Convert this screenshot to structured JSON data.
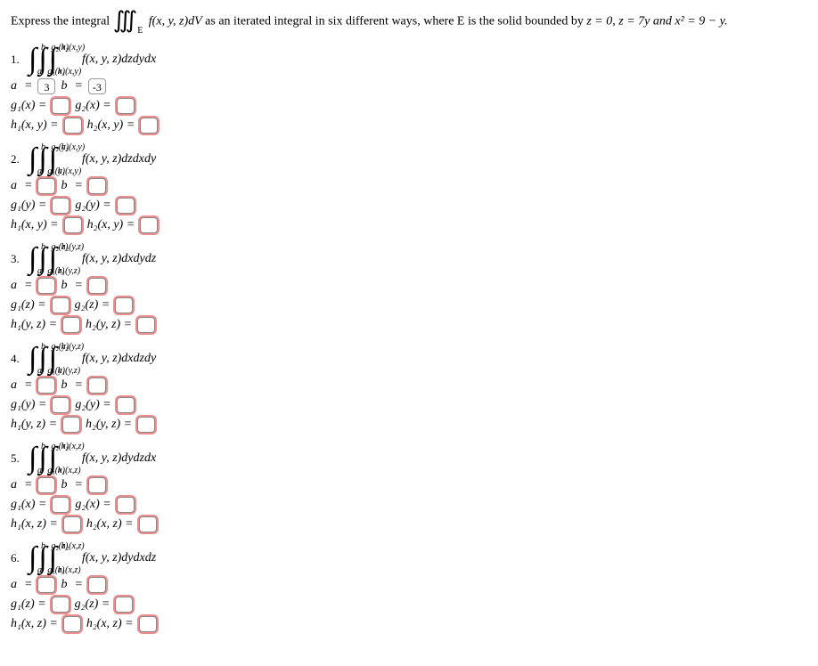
{
  "intro": {
    "lead": "Express the integral",
    "iiint": "∭",
    "sub": "E",
    "fn": "f(x, y, z)dV",
    "mid": " as an iterated integral in six different ways, where E is the solid bounded by ",
    "cond": "z = 0, z = 7y and x² = 9 − y."
  },
  "problems": [
    {
      "n": "1.",
      "lim1_top": "b",
      "lim1_bot": "a",
      "lim2_top": "g₂(x)",
      "lim2_bot": "g₁(x)",
      "lim3_top": "h₂(x,y)",
      "lim3_bot": "h₁(x,y)",
      "integrand": "f(x, y, z)dzdydx",
      "a_val": "3",
      "b_val": "-3",
      "a_filled": true,
      "b_filled": true,
      "g1": "g₁(x) =",
      "g2": "g₂(x) =",
      "h1": "h₁(x, y) =",
      "h2": "h₂(x, y) ="
    },
    {
      "n": "2.",
      "lim1_top": "b",
      "lim1_bot": "a",
      "lim2_top": "g₂(y)",
      "lim2_bot": "g₁(y)",
      "lim3_top": "h₂(x,y)",
      "lim3_bot": "h₁(x,y)",
      "integrand": "f(x, y, z)dzdxdy",
      "a_val": "",
      "b_val": "",
      "a_filled": false,
      "b_filled": false,
      "g1": "g₁(y) =",
      "g2": "g₂(y) =",
      "h1": "h₁(x, y) =",
      "h2": "h₂(x, y) ="
    },
    {
      "n": "3.",
      "lim1_top": "b",
      "lim1_bot": "a",
      "lim2_top": "g₂(z)",
      "lim2_bot": "g₁(z)",
      "lim3_top": "h₂(y,z)",
      "lim3_bot": "h₁(y,z)",
      "integrand": "f(x, y, z)dxdydz",
      "a_val": "",
      "b_val": "",
      "a_filled": false,
      "b_filled": false,
      "g1": "g₁(z) =",
      "g2": "g₂(z) =",
      "h1": "h₁(y, z) =",
      "h2": "h₂(y, z) ="
    },
    {
      "n": "4.",
      "lim1_top": "b",
      "lim1_bot": "a",
      "lim2_top": "g₂(y)",
      "lim2_bot": "g₁(y)",
      "lim3_top": "h₂(y,z)",
      "lim3_bot": "h₁(y,z)",
      "integrand": "f(x, y, z)dxdzdy",
      "a_val": "",
      "b_val": "",
      "a_filled": false,
      "b_filled": false,
      "g1": "g₁(y) =",
      "g2": "g₂(y) =",
      "h1": "h₁(y, z) =",
      "h2": "h₂(y, z) ="
    },
    {
      "n": "5.",
      "lim1_top": "b",
      "lim1_bot": "a",
      "lim2_top": "g₂(x)",
      "lim2_bot": "g₁(x)",
      "lim3_top": "h₂(x,z)",
      "lim3_bot": "h₁(x,z)",
      "integrand": "f(x, y, z)dydzdx",
      "a_val": "",
      "b_val": "",
      "a_filled": false,
      "b_filled": false,
      "g1": "g₁(x) =",
      "g2": "g₂(x) =",
      "h1": "h₁(x, z) =",
      "h2": "h₂(x, z) ="
    },
    {
      "n": "6.",
      "lim1_top": "b",
      "lim1_bot": "a",
      "lim2_top": "g₂(z)",
      "lim2_bot": "g₁(z)",
      "lim3_top": "h₂(x,z)",
      "lim3_bot": "h₁(x,z)",
      "integrand": "f(x, y, z)dydxdz",
      "a_val": "",
      "b_val": "",
      "a_filled": false,
      "b_filled": false,
      "g1": "g₁(z) =",
      "g2": "g₂(z) =",
      "h1": "h₁(x, z) =",
      "h2": "h₂(x, z) ="
    }
  ]
}
